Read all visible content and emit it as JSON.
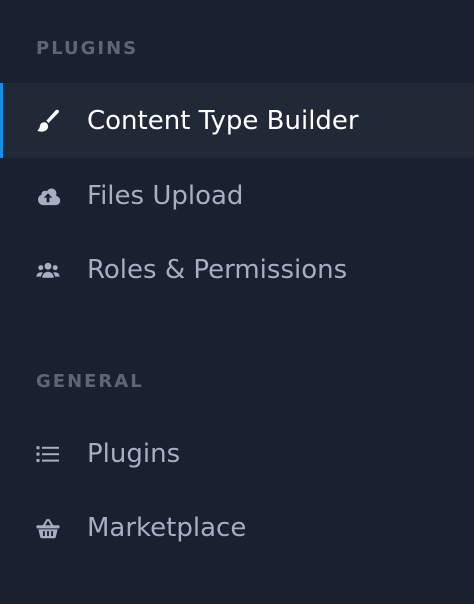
{
  "colors": {
    "background": "#1b2030",
    "active_background": "#212836",
    "active_accent": "#1c8de0",
    "section_title": "#5e6575",
    "item_text": "#a6afc2",
    "active_text": "#ffffff"
  },
  "sections": [
    {
      "title": "PLUGINS",
      "items": [
        {
          "label": "Content Type Builder",
          "icon": "paintbrush-icon",
          "active": true
        },
        {
          "label": "Files Upload",
          "icon": "cloud-upload-icon",
          "active": false
        },
        {
          "label": "Roles & Permissions",
          "icon": "users-icon",
          "active": false
        }
      ]
    },
    {
      "title": "GENERAL",
      "items": [
        {
          "label": "Plugins",
          "icon": "list-icon",
          "active": false
        },
        {
          "label": "Marketplace",
          "icon": "shopping-basket-icon",
          "active": false
        }
      ]
    }
  ]
}
